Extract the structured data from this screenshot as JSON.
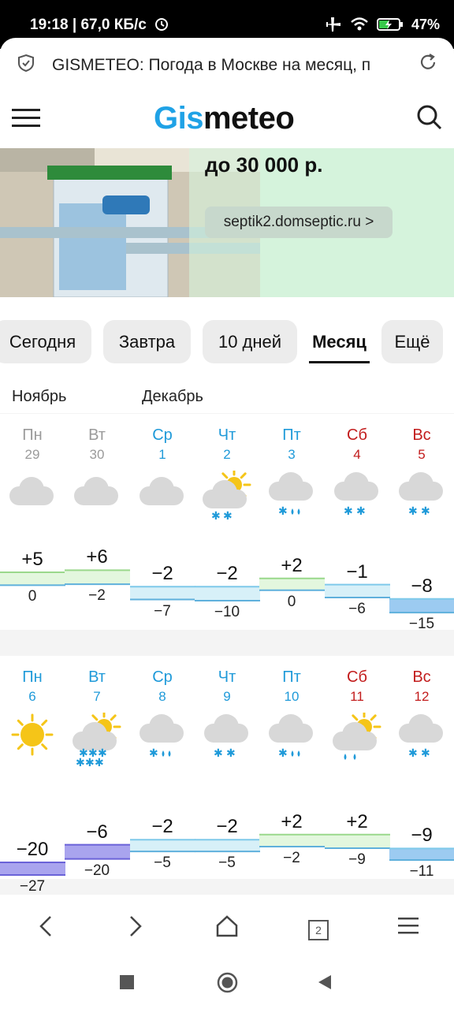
{
  "status_bar": {
    "time_speed": "19:18 | 67,0 КБ/с",
    "battery": "47%",
    "icons": [
      "alarm-icon",
      "airplane-icon",
      "wifi-icon",
      "battery-charging-icon"
    ]
  },
  "browser": {
    "url_title": "GISMETEO: Погода в Москве на месяц, п"
  },
  "header": {
    "logo_part1": "Gis",
    "logo_part2": "meteo"
  },
  "ad": {
    "title": "до 30 000 р.",
    "link": "septik2.domseptic.ru >"
  },
  "tabs": [
    {
      "label": "Сегодня"
    },
    {
      "label": "Завтра"
    },
    {
      "label": "10 дней"
    },
    {
      "label": "Месяц",
      "active": true
    },
    {
      "label": "Ещё"
    }
  ],
  "months": [
    "Ноябрь",
    "Декабрь"
  ],
  "weeks": [
    {
      "days": [
        {
          "name": "Пн",
          "num": "29",
          "max": "+5",
          "min": "0",
          "icon": "cloudy"
        },
        {
          "name": "Вт",
          "num": "30",
          "max": "+6",
          "min": "−2",
          "icon": "cloudy"
        },
        {
          "name": "Ср",
          "num": "1",
          "max": "−2",
          "min": "−7",
          "icon": "cloudy"
        },
        {
          "name": "Чт",
          "num": "2",
          "max": "−2",
          "min": "−10",
          "icon": "partly-cloudy-snow"
        },
        {
          "name": "Пт",
          "num": "3",
          "max": "+2",
          "min": "0",
          "icon": "cloudy-snow-rain"
        },
        {
          "name": "Сб",
          "num": "4",
          "max": "−1",
          "min": "−6",
          "icon": "cloudy-snow"
        },
        {
          "name": "Вс",
          "num": "5",
          "max": "−8",
          "min": "−15",
          "icon": "cloudy-snow"
        }
      ]
    },
    {
      "days": [
        {
          "name": "Пн",
          "num": "6",
          "max": "−20",
          "min": "−27",
          "icon": "sunny"
        },
        {
          "name": "Вт",
          "num": "7",
          "max": "−6",
          "min": "−20",
          "icon": "partly-cloudy-heavy-snow"
        },
        {
          "name": "Ср",
          "num": "8",
          "max": "−2",
          "min": "−5",
          "icon": "cloudy-snow-rain"
        },
        {
          "name": "Чт",
          "num": "9",
          "max": "−2",
          "min": "−5",
          "icon": "cloudy-snow"
        },
        {
          "name": "Пт",
          "num": "10",
          "max": "+2",
          "min": "−2",
          "icon": "cloudy-snow-rain"
        },
        {
          "name": "Сб",
          "num": "11",
          "max": "+2",
          "min": "−9",
          "icon": "partly-cloudy-rain"
        },
        {
          "name": "Вс",
          "num": "12",
          "max": "−9",
          "min": "−11",
          "icon": "cloudy-snow"
        }
      ]
    }
  ],
  "bottom_nav": {
    "tab_count": "2",
    "icons": [
      "back-arrow-icon",
      "forward-arrow-icon",
      "home-icon",
      "tabs-icon",
      "menu-icon"
    ]
  },
  "system_nav": {
    "icons": [
      "recents-icon",
      "home-circle-icon",
      "back-triangle-icon"
    ]
  }
}
